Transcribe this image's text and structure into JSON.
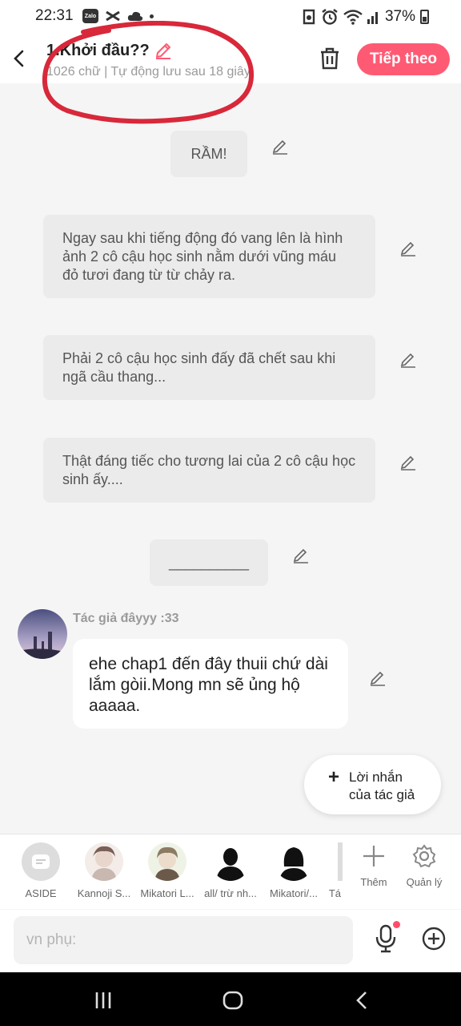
{
  "status_bar": {
    "time": "22:31",
    "zalo": "Zalo",
    "battery": "37%",
    "icons": [
      "zalo-icon",
      "capcut-icon",
      "cloud-icon",
      "notification-dot",
      "data-saver-icon",
      "alarm-icon",
      "wifi-icon",
      "signal-icon",
      "battery-icon"
    ]
  },
  "header": {
    "title": "1.Khởi đầu??",
    "meta": "1026 chữ | Tự động lưu sau 18 giây",
    "next_label": "Tiếp theo",
    "accent": "#ff5a74",
    "annotation_color": "#d8283a"
  },
  "messages": [
    {
      "text": "RẦM!"
    },
    {
      "text": "Ngay sau khi tiếng động đó vang lên là hình ảnh 2 cô cậu học sinh nằm dưới vũng máu đỏ tươi đang từ từ chảy ra."
    },
    {
      "text": "Phải 2 cô cậu học sinh đấy đã chết sau khi ngã cầu thang..."
    },
    {
      "text": "Thật đáng tiếc cho tương lai của 2 cô cậu học sinh ấy...."
    },
    {
      "text": "__________"
    }
  ],
  "author_message": {
    "name": "Tác giả đâyyy :33",
    "text": "ehe chap1 đến đây thuii chứ dài lắm gòii.Mong mn sẽ ủng hộ aaaaa."
  },
  "note_button": {
    "label_line1": "Lời nhắn",
    "label_line2": "của tác giả"
  },
  "characters": [
    {
      "name": "ASIDE",
      "icon": "aside-icon"
    },
    {
      "name": "Kannoji S..."
    },
    {
      "name": "Mikatori L..."
    },
    {
      "name": "all/ trừ nh..."
    },
    {
      "name": "Mikatori/..."
    },
    {
      "name": "Tá"
    }
  ],
  "tools": {
    "more": "Thêm",
    "manage": "Quản lý"
  },
  "input": {
    "placeholder": "vn phụ:"
  }
}
